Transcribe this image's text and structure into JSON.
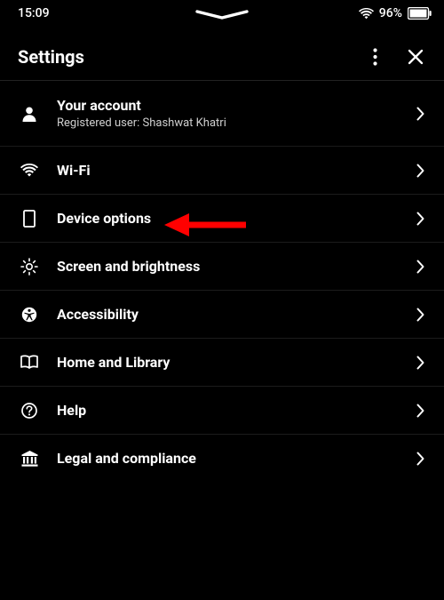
{
  "status": {
    "time": "15:09",
    "battery_pct": "96%"
  },
  "header": {
    "title": "Settings"
  },
  "items": {
    "account": {
      "title": "Your account",
      "subtitle": "Registered user: Shashwat Khatri"
    },
    "wifi": {
      "title": "Wi-Fi"
    },
    "device": {
      "title": "Device options"
    },
    "screen": {
      "title": "Screen and brightness"
    },
    "accessibility": {
      "title": "Accessibility"
    },
    "home": {
      "title": "Home and Library"
    },
    "help": {
      "title": "Help"
    },
    "legal": {
      "title": "Legal and compliance"
    }
  },
  "annotation": {
    "highlighted_item": "device",
    "arrow_color": "#ff0000"
  }
}
